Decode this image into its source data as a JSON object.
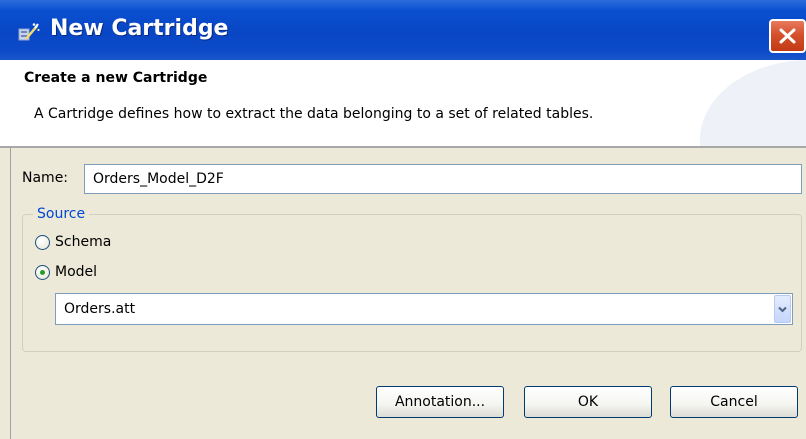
{
  "window": {
    "title": "New Cartridge",
    "icon": "wizard-icon",
    "close_icon": "close-icon"
  },
  "header": {
    "title": "Create a new Cartridge",
    "description": "A Cartridge defines how to extract the data belonging to a set of related tables."
  },
  "form": {
    "name_label": "Name:",
    "name_value": "Orders_Model_D2F",
    "source": {
      "legend": "Source",
      "options": [
        {
          "label": "Schema",
          "checked": false
        },
        {
          "label": "Model",
          "checked": true
        }
      ],
      "model_select": {
        "value": "Orders.att",
        "arrow_icon": "chevron-down-icon"
      }
    }
  },
  "buttons": {
    "annotation": "Annotation...",
    "ok": "OK",
    "cancel": "Cancel"
  },
  "colors": {
    "title_bar": "#0846c5",
    "close_button": "#d5512e",
    "dialog_background": "#ece9d8",
    "group_legend": "#0046d5",
    "radio_checked_dot": "#21a121"
  }
}
